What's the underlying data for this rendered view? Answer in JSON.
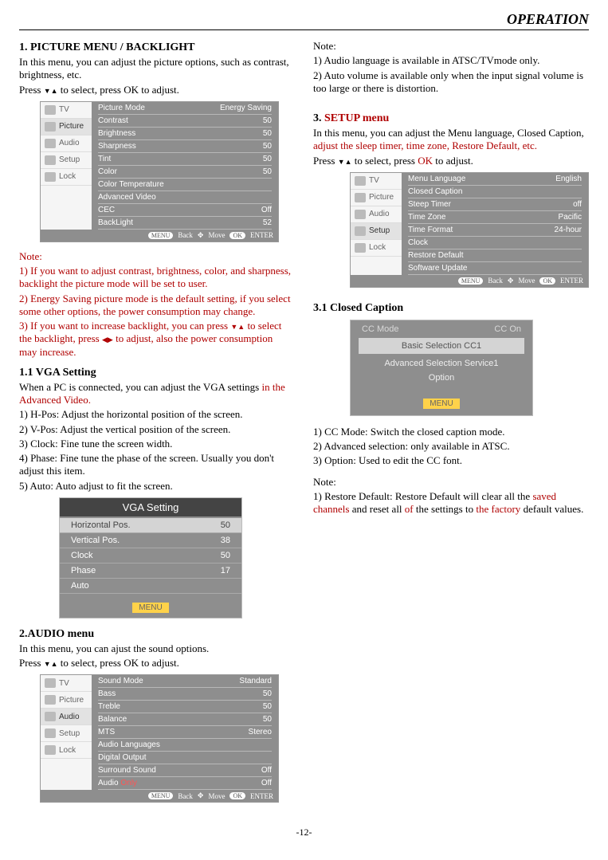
{
  "header": "OPERATION",
  "page_number": "-12-",
  "left": {
    "s1_title": "1. PICTURE MENU / BACKLIGHT",
    "s1_p1": "In this menu, you can adjust the picture options, such as contrast, brightness, etc.",
    "s1_p2a": "Press ",
    "s1_p2b": " to select, press OK to adjust.",
    "note_label": "Note:",
    "note1": "1) If you want to adjust contrast, brightness, color, and sharpness, backlight the picture mode will be set to user.",
    "note2": "2) Energy Saving picture mode is the default setting, if you select some other options, the power consumption may change.",
    "note3a": "3) If you want to increase backlight, you can press ",
    "note3b": " to select the backlight, press ",
    "note3c": " to adjust, also the power consumption may increase.",
    "s11_title": "1.1 VGA Setting",
    "s11_p1a": "When a PC is connected, you can adjust the VGA settings ",
    "s11_p1b": "in the Advanced Video.",
    "s11_l1": "1) H-Pos: Adjust the horizontal position of the screen.",
    "s11_l2": "2) V-Pos: Adjust the vertical position of the screen.",
    "s11_l3": "3) Clock: Fine tune the screen width.",
    "s11_l4": "4) Phase: Fine tune the phase of the screen. Usually  you don't adjust this item.",
    "s11_l5": "5) Auto: Auto adjust to fit the screen.",
    "s2_title": "2.AUDIO menu",
    "s2_p1": "In this menu, you can ajust the sound options.",
    "s2_p2a": "Press ",
    "s2_p2b": " to select, press OK to adjust."
  },
  "right": {
    "note_label": "Note:",
    "rn1": "1) Audio language is available in ATSC/TVmode only.",
    "rn2": "2) Auto volume is available only when the input signal volume is too large or there is distortion.",
    "s3_title_a": "3. ",
    "s3_title_b": "SETUP menu",
    "s3_p1a": "In this menu, you can adjust the Menu language, Closed Caption, ",
    "s3_p1b": "adjust the sleep timer, time zone, Restore Default, etc.",
    "s3_p2a": "Press ",
    "s3_p2b": " to select, press ",
    "s3_p2c": "OK",
    "s3_p2d": " to adjust.",
    "s31_title": "3.1 Closed Caption",
    "cc1": "1) CC Mode: Switch the closed caption mode.",
    "cc2": "2) Advanced selection: only available in  ATSC.",
    "cc3": "3) Option: Used to edit the CC font.",
    "rd_a": "1) Restore Default: Restore Default will clear all the ",
    "rd_b": "saved channels",
    "rd_c": " and reset all ",
    "rd_d": "of",
    "rd_e": " the settings to ",
    "rd_f": "the factory",
    "rd_g": " default values."
  },
  "osd_tabs": [
    "TV",
    "Picture",
    "Audio",
    "Setup",
    "Lock"
  ],
  "osd_picture": {
    "rows": [
      {
        "l": "Picture Mode",
        "v": "Energy Saving"
      },
      {
        "l": "Contrast",
        "v": "50"
      },
      {
        "l": "Brightness",
        "v": "50"
      },
      {
        "l": "Sharpness",
        "v": "50"
      },
      {
        "l": "Tint",
        "v": "50"
      },
      {
        "l": "Color",
        "v": "50"
      },
      {
        "l": "Color Temperature",
        "v": ""
      },
      {
        "l": "Advanced Video",
        "v": ""
      },
      {
        "l": "CEC",
        "v": "Off"
      },
      {
        "l": "BackLight",
        "v": "52"
      }
    ]
  },
  "osd_footer": {
    "menu": "MENU",
    "back": "Back",
    "move": "Move",
    "ok": "OK",
    "enter": "ENTER"
  },
  "vga": {
    "title": "VGA Setting",
    "rows": [
      {
        "l": "Horizontal Pos.",
        "v": "50"
      },
      {
        "l": "Vertical Pos.",
        "v": "38"
      },
      {
        "l": "Clock",
        "v": "50"
      },
      {
        "l": "Phase",
        "v": "17"
      },
      {
        "l": "Auto",
        "v": ""
      }
    ],
    "menu": "MENU"
  },
  "osd_audio": {
    "rows": [
      {
        "l": "Sound Mode",
        "v": "Standard"
      },
      {
        "l": "Bass",
        "v": "50"
      },
      {
        "l": "Treble",
        "v": "50"
      },
      {
        "l": "Balance",
        "v": "50"
      },
      {
        "l": "MTS",
        "v": "Stereo"
      },
      {
        "l": "Audio Languages",
        "v": ""
      },
      {
        "l": "Digital Output",
        "v": ""
      },
      {
        "l": "Surround Sound",
        "v": "Off"
      },
      {
        "l": "Audio Only",
        "v": "Off"
      }
    ],
    "only_red": "Only"
  },
  "osd_setup": {
    "rows": [
      {
        "l": "Menu Language",
        "v": "English"
      },
      {
        "l": "Closed Caption",
        "v": ""
      },
      {
        "l": "Steep Timer",
        "v": "off"
      },
      {
        "l": "Time Zone",
        "v": "Pacific"
      },
      {
        "l": "Time Format",
        "v": "24-hour"
      },
      {
        "l": "Clock",
        "v": ""
      },
      {
        "l": "Restore Default",
        "v": ""
      },
      {
        "l": "Software Update",
        "v": ""
      }
    ]
  },
  "cc": {
    "mode_l": "CC Mode",
    "mode_v": "CC On",
    "basic": "Basic Selection CC1",
    "adv": "Advanced Selection Service1",
    "opt": "Option",
    "menu": "MENU"
  }
}
